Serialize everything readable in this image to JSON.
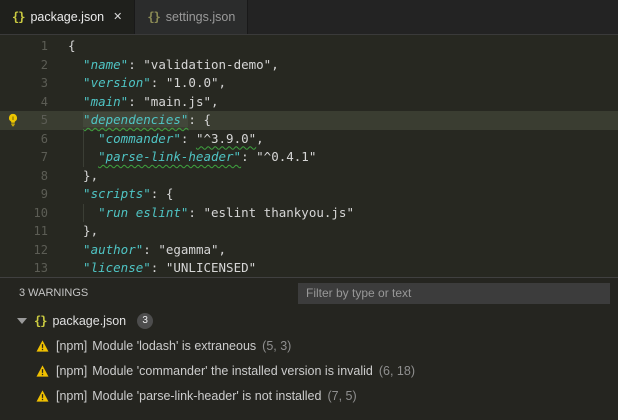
{
  "colors": {
    "editor_bg": "#272821",
    "line_highlight": "#3a3d31",
    "key_color": "#4fc4c4",
    "string_color": "#d6d6d6",
    "json_icon_color": "#cbcb41",
    "warning_color": "#f0c000",
    "squiggle_color": "#3fa33f",
    "filter_bg": "#3c3c3c"
  },
  "tabs": [
    {
      "label": "package.json",
      "icon_glyph": "{}",
      "close_glyph": "✕",
      "active": true
    },
    {
      "label": "settings.json",
      "icon_glyph": "{}",
      "active": false
    }
  ],
  "editor": {
    "lines": [
      {
        "num": "1",
        "indent": 0,
        "tokens": [
          {
            "type": "punc",
            "text": "{"
          }
        ]
      },
      {
        "num": "2",
        "indent": 2,
        "tokens": [
          {
            "type": "key",
            "text": "\"name\""
          },
          {
            "type": "punc",
            "text": ": "
          },
          {
            "type": "str",
            "text": "\"validation-demo\""
          },
          {
            "type": "punc",
            "text": ","
          }
        ]
      },
      {
        "num": "3",
        "indent": 2,
        "tokens": [
          {
            "type": "key",
            "text": "\"version\""
          },
          {
            "type": "punc",
            "text": ": "
          },
          {
            "type": "str",
            "text": "\"1.0.0\""
          },
          {
            "type": "punc",
            "text": ","
          }
        ]
      },
      {
        "num": "4",
        "indent": 2,
        "tokens": [
          {
            "type": "key",
            "text": "\"main\""
          },
          {
            "type": "punc",
            "text": ": "
          },
          {
            "type": "str",
            "text": "\"main.js\""
          },
          {
            "type": "punc",
            "text": ","
          }
        ]
      },
      {
        "num": "5",
        "indent": 2,
        "current": true,
        "lightbulb": true,
        "tokens": [
          {
            "type": "key",
            "text": "\"dependencies\"",
            "squiggle": true,
            "highlight": true
          },
          {
            "type": "punc",
            "text": ": {"
          }
        ]
      },
      {
        "num": "6",
        "indent": 4,
        "tokens": [
          {
            "type": "key",
            "text": "\"commander\""
          },
          {
            "type": "punc",
            "text": ": "
          },
          {
            "type": "str",
            "text": "\"^3.9.0\"",
            "squiggle": true
          },
          {
            "type": "punc",
            "text": ","
          }
        ]
      },
      {
        "num": "7",
        "indent": 4,
        "tokens": [
          {
            "type": "key",
            "text": "\"parse-link-header\"",
            "squiggle": true
          },
          {
            "type": "punc",
            "text": ": "
          },
          {
            "type": "str",
            "text": "\"^0.4.1\""
          }
        ]
      },
      {
        "num": "8",
        "indent": 2,
        "tokens": [
          {
            "type": "punc",
            "text": "},"
          }
        ]
      },
      {
        "num": "9",
        "indent": 2,
        "tokens": [
          {
            "type": "key",
            "text": "\"scripts\""
          },
          {
            "type": "punc",
            "text": ": {"
          }
        ]
      },
      {
        "num": "10",
        "indent": 4,
        "tokens": [
          {
            "type": "key",
            "text": "\"run eslint\""
          },
          {
            "type": "punc",
            "text": ": "
          },
          {
            "type": "str",
            "text": "\"eslint thankyou.js\""
          }
        ]
      },
      {
        "num": "11",
        "indent": 2,
        "tokens": [
          {
            "type": "punc",
            "text": "},"
          }
        ]
      },
      {
        "num": "12",
        "indent": 2,
        "tokens": [
          {
            "type": "key",
            "text": "\"author\""
          },
          {
            "type": "punc",
            "text": ": "
          },
          {
            "type": "str",
            "text": "\"egamma\""
          },
          {
            "type": "punc",
            "text": ","
          }
        ]
      },
      {
        "num": "13",
        "indent": 2,
        "tokens": [
          {
            "type": "key",
            "text": "\"license\""
          },
          {
            "type": "punc",
            "text": ": "
          },
          {
            "type": "str",
            "text": "\"UNLICENSED\""
          }
        ]
      }
    ]
  },
  "problems": {
    "summary": "3 WARNINGS",
    "filter_placeholder": "Filter by type or text",
    "file": {
      "name": "package.json",
      "badge": "3",
      "icon_glyph": "{}"
    },
    "warnings": [
      {
        "source": "[npm]",
        "message": "Module 'lodash' is extraneous",
        "position": "(5, 3)"
      },
      {
        "source": "[npm]",
        "message": "Module 'commander' the installed version is invalid",
        "position": "(6, 18)"
      },
      {
        "source": "[npm]",
        "message": "Module 'parse-link-header' is not installed",
        "position": "(7, 5)"
      }
    ]
  }
}
